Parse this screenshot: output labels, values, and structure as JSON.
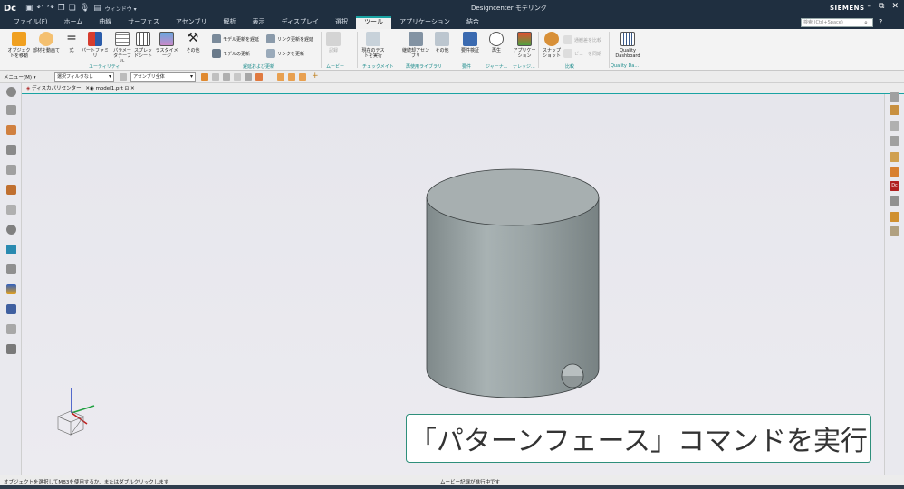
{
  "app": {
    "logo": "Dc",
    "window_title": "Designcenter モデリング",
    "brand": "SIEMENS",
    "window_menu_label": "ウィンドウ ▾",
    "winctl": [
      "–",
      "⧉",
      "✕"
    ]
  },
  "menu_tabs": [
    "ファイル(F)",
    "ホーム",
    "曲線",
    "サーフェス",
    "アセンブリ",
    "解析",
    "表示",
    "ディスプレイ",
    "選択",
    "ツール",
    "アプリケーション",
    "結合"
  ],
  "active_tab": "ツール",
  "search": {
    "placeholder": "検索 (Ctrl+Space)"
  },
  "ribbon": {
    "buttons": [
      {
        "id": "obj-move",
        "label": "オブジェクトを移動"
      },
      {
        "id": "mat-move",
        "label": "部材を動画て"
      },
      {
        "id": "expr",
        "label": "式"
      },
      {
        "id": "part-family",
        "label": "パートファミリ"
      },
      {
        "id": "param-table",
        "label": "パラメータテーブル"
      },
      {
        "id": "spreadsheet",
        "label": "スプレッドシート"
      },
      {
        "id": "raster-image",
        "label": "ラスタイメージ"
      },
      {
        "id": "other1",
        "label": "その他"
      },
      {
        "id": "current-test",
        "label": "現在のテストを実行"
      },
      {
        "id": "feature-lib",
        "label": "継続却アセンブリ"
      },
      {
        "id": "other2",
        "label": "その他"
      },
      {
        "id": "req-verify",
        "label": "要件検証"
      },
      {
        "id": "replay",
        "label": "再生"
      },
      {
        "id": "app-journal",
        "label": "アプリケーション"
      },
      {
        "id": "snapshot",
        "label": "スナップショット"
      },
      {
        "id": "quality",
        "label": "Quality Dashboard"
      }
    ],
    "small_buttons": {
      "model_update_1": "モデル更新を遅延",
      "link_update": "リンク更新を遅延",
      "model_update_2": "モデルの更新",
      "link_update_2": "リンクを更新",
      "compare_1": "通観差を比較",
      "compare_2": "ビューを同期"
    },
    "groups": [
      "ユーティリティ",
      "遅延および更新",
      "ムービー",
      "チェックメイト",
      "再使用ライブラリ",
      "要件",
      "ジャーナ...",
      "ナレッジ...",
      "比較",
      "Quality Da..."
    ]
  },
  "toolbar2": {
    "menu_label": "メニュー(M) ▾",
    "filter_select": "選択フィルタなし",
    "scope_select": "アセンブリ全体"
  },
  "doc_tabs": [
    {
      "label": "ディスカバリセンター"
    },
    {
      "label": "model1.prt"
    }
  ],
  "caption": "「パターンフェース」コマンドを実行",
  "status": {
    "left": "オブジェクトを選択してMB3を使用するか、またはダブルクリックします",
    "center": "ムービー記録が進行中です"
  },
  "colors": {
    "accent": "#1aa3a3",
    "title_bg": "#1f2f40",
    "caption_border": "#2e8f7b",
    "cylinder": "#9ba5a6"
  }
}
